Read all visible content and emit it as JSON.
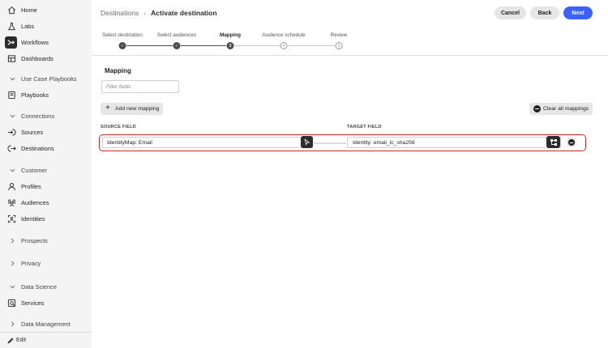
{
  "sidebar": {
    "items": [
      {
        "label": "Home",
        "icon": "home-icon"
      },
      {
        "label": "Labs",
        "icon": "flask-icon"
      },
      {
        "label": "Workflows",
        "icon": "workflow-icon"
      },
      {
        "label": "Dashboards",
        "icon": "dashboard-icon"
      },
      {
        "label": "Use Case Playbooks",
        "icon": "chevron-down-icon"
      },
      {
        "label": "Playbooks",
        "icon": "book-icon"
      },
      {
        "label": "Connections",
        "icon": "chevron-down-icon"
      },
      {
        "label": "Sources",
        "icon": "source-icon"
      },
      {
        "label": "Destinations",
        "icon": "destination-icon"
      },
      {
        "label": "Customer",
        "icon": "chevron-down-icon"
      },
      {
        "label": "Profiles",
        "icon": "user-icon"
      },
      {
        "label": "Audiences",
        "icon": "audiences-icon"
      },
      {
        "label": "Identities",
        "icon": "identity-icon"
      },
      {
        "label": "Prospects",
        "icon": "chevron-right-icon"
      },
      {
        "label": "Privacy",
        "icon": "chevron-right-icon"
      },
      {
        "label": "Data Science",
        "icon": "chevron-down-icon"
      },
      {
        "label": "Services",
        "icon": "services-icon"
      },
      {
        "label": "Data Management",
        "icon": "chevron-right-icon"
      }
    ],
    "footer_label": "Edit"
  },
  "header": {
    "breadcrumb_parent": "Destinations",
    "breadcrumb_current": "Activate destination",
    "cancel_label": "Cancel",
    "back_label": "Back",
    "next_label": "Next"
  },
  "steps": [
    {
      "label": "Select destination",
      "state": "done",
      "marker": "✓"
    },
    {
      "label": "Select audiences",
      "state": "done",
      "marker": "✓"
    },
    {
      "label": "Mapping",
      "state": "current",
      "marker": "3"
    },
    {
      "label": "Audience schedule",
      "state": "todo",
      "marker": "4"
    },
    {
      "label": "Review",
      "state": "todo",
      "marker": "5"
    }
  ],
  "mapping": {
    "title": "Mapping",
    "filter_placeholder": "Filter fields",
    "add_label": "Add new mapping",
    "clear_label": "Clear all mappings",
    "source_header": "SOURCE FIELD",
    "target_header": "TARGET FIELD",
    "rows": [
      {
        "source": "IdentityMap: Email",
        "target": "Identity: email_lc_sha256"
      }
    ]
  },
  "colors": {
    "accent": "#3b63fb",
    "highlight": "#d6252e"
  }
}
